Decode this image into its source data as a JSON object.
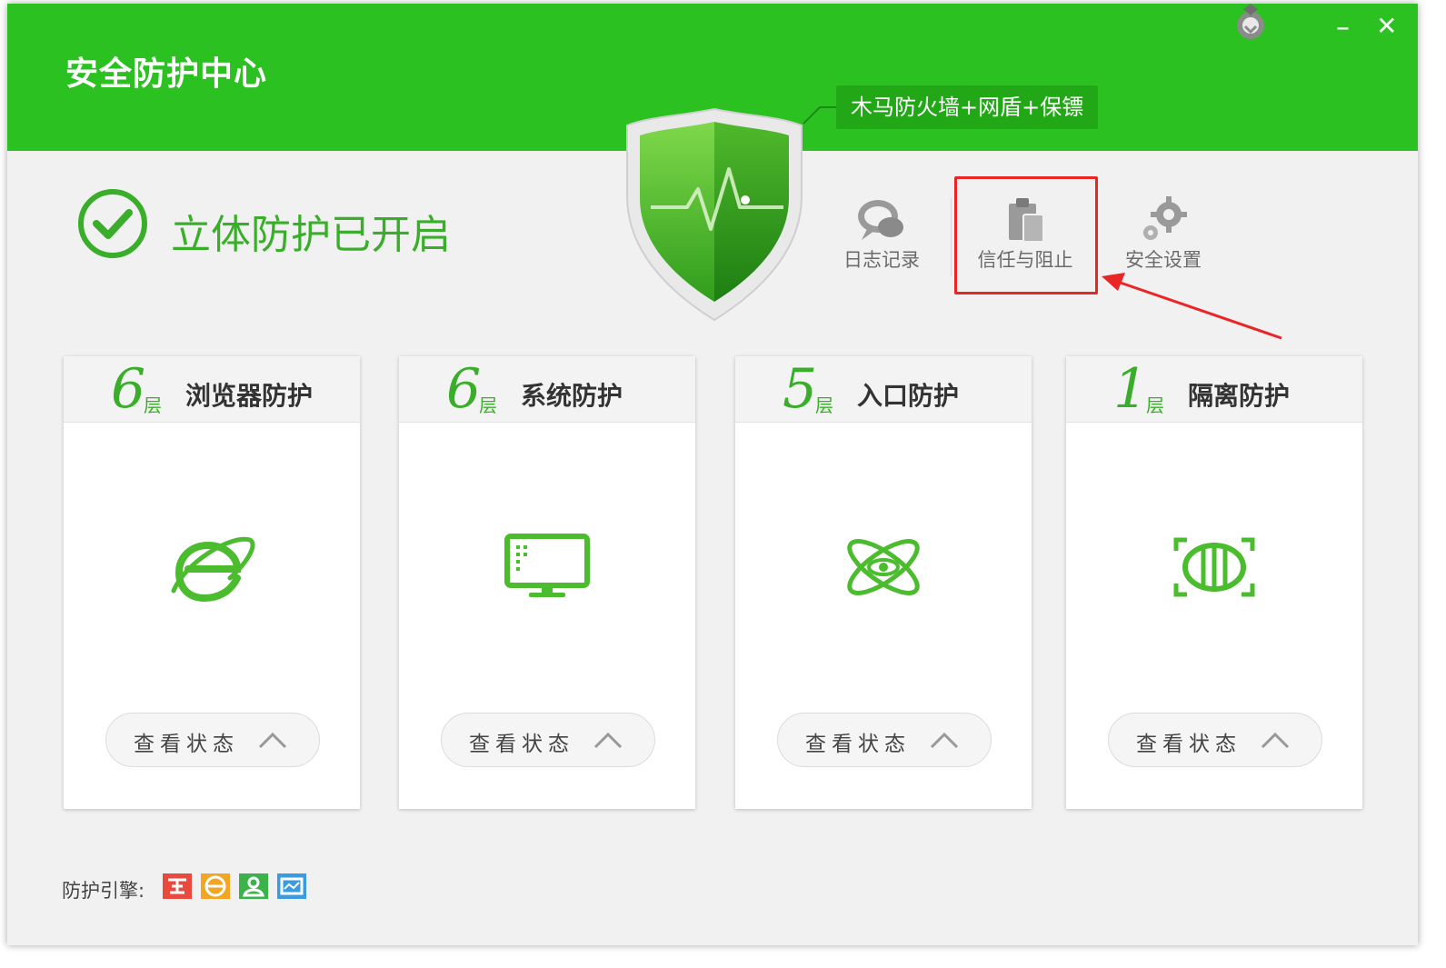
{
  "app": {
    "title": "安全防护中心",
    "badge": "木马防火墙+网盾+保镖"
  },
  "status": {
    "text": "立体防护已开启"
  },
  "tools": [
    {
      "label": "日志记录",
      "icon": "chat-bubbles-icon"
    },
    {
      "label": "信任与阻止",
      "icon": "clipboard-icon"
    },
    {
      "label": "安全设置",
      "icon": "gears-icon"
    }
  ],
  "cards": [
    {
      "num": "6",
      "layer": "层",
      "title": "浏览器防护",
      "icon": "browser-e-icon",
      "button": "查看状态"
    },
    {
      "num": "6",
      "layer": "层",
      "title": "系统防护",
      "icon": "monitor-icon",
      "button": "查看状态"
    },
    {
      "num": "5",
      "layer": "层",
      "title": "入口防护",
      "icon": "atom-icon",
      "button": "查看状态"
    },
    {
      "num": "1",
      "layer": "层",
      "title": "隔离防护",
      "icon": "isolation-icon",
      "button": "查看状态"
    }
  ],
  "engine": {
    "label": "防护引擎:",
    "icons": [
      {
        "name": "engine-red-icon",
        "color": "#e84a3d"
      },
      {
        "name": "engine-orange-icon",
        "color": "#f3a623"
      },
      {
        "name": "engine-green-icon",
        "color": "#3bb24a"
      },
      {
        "name": "engine-blue-icon",
        "color": "#3b9be0"
      }
    ]
  },
  "colors": {
    "brand_green": "#2bc120",
    "accent_green": "#3aae2b",
    "highlight_red": "#ea2525"
  }
}
